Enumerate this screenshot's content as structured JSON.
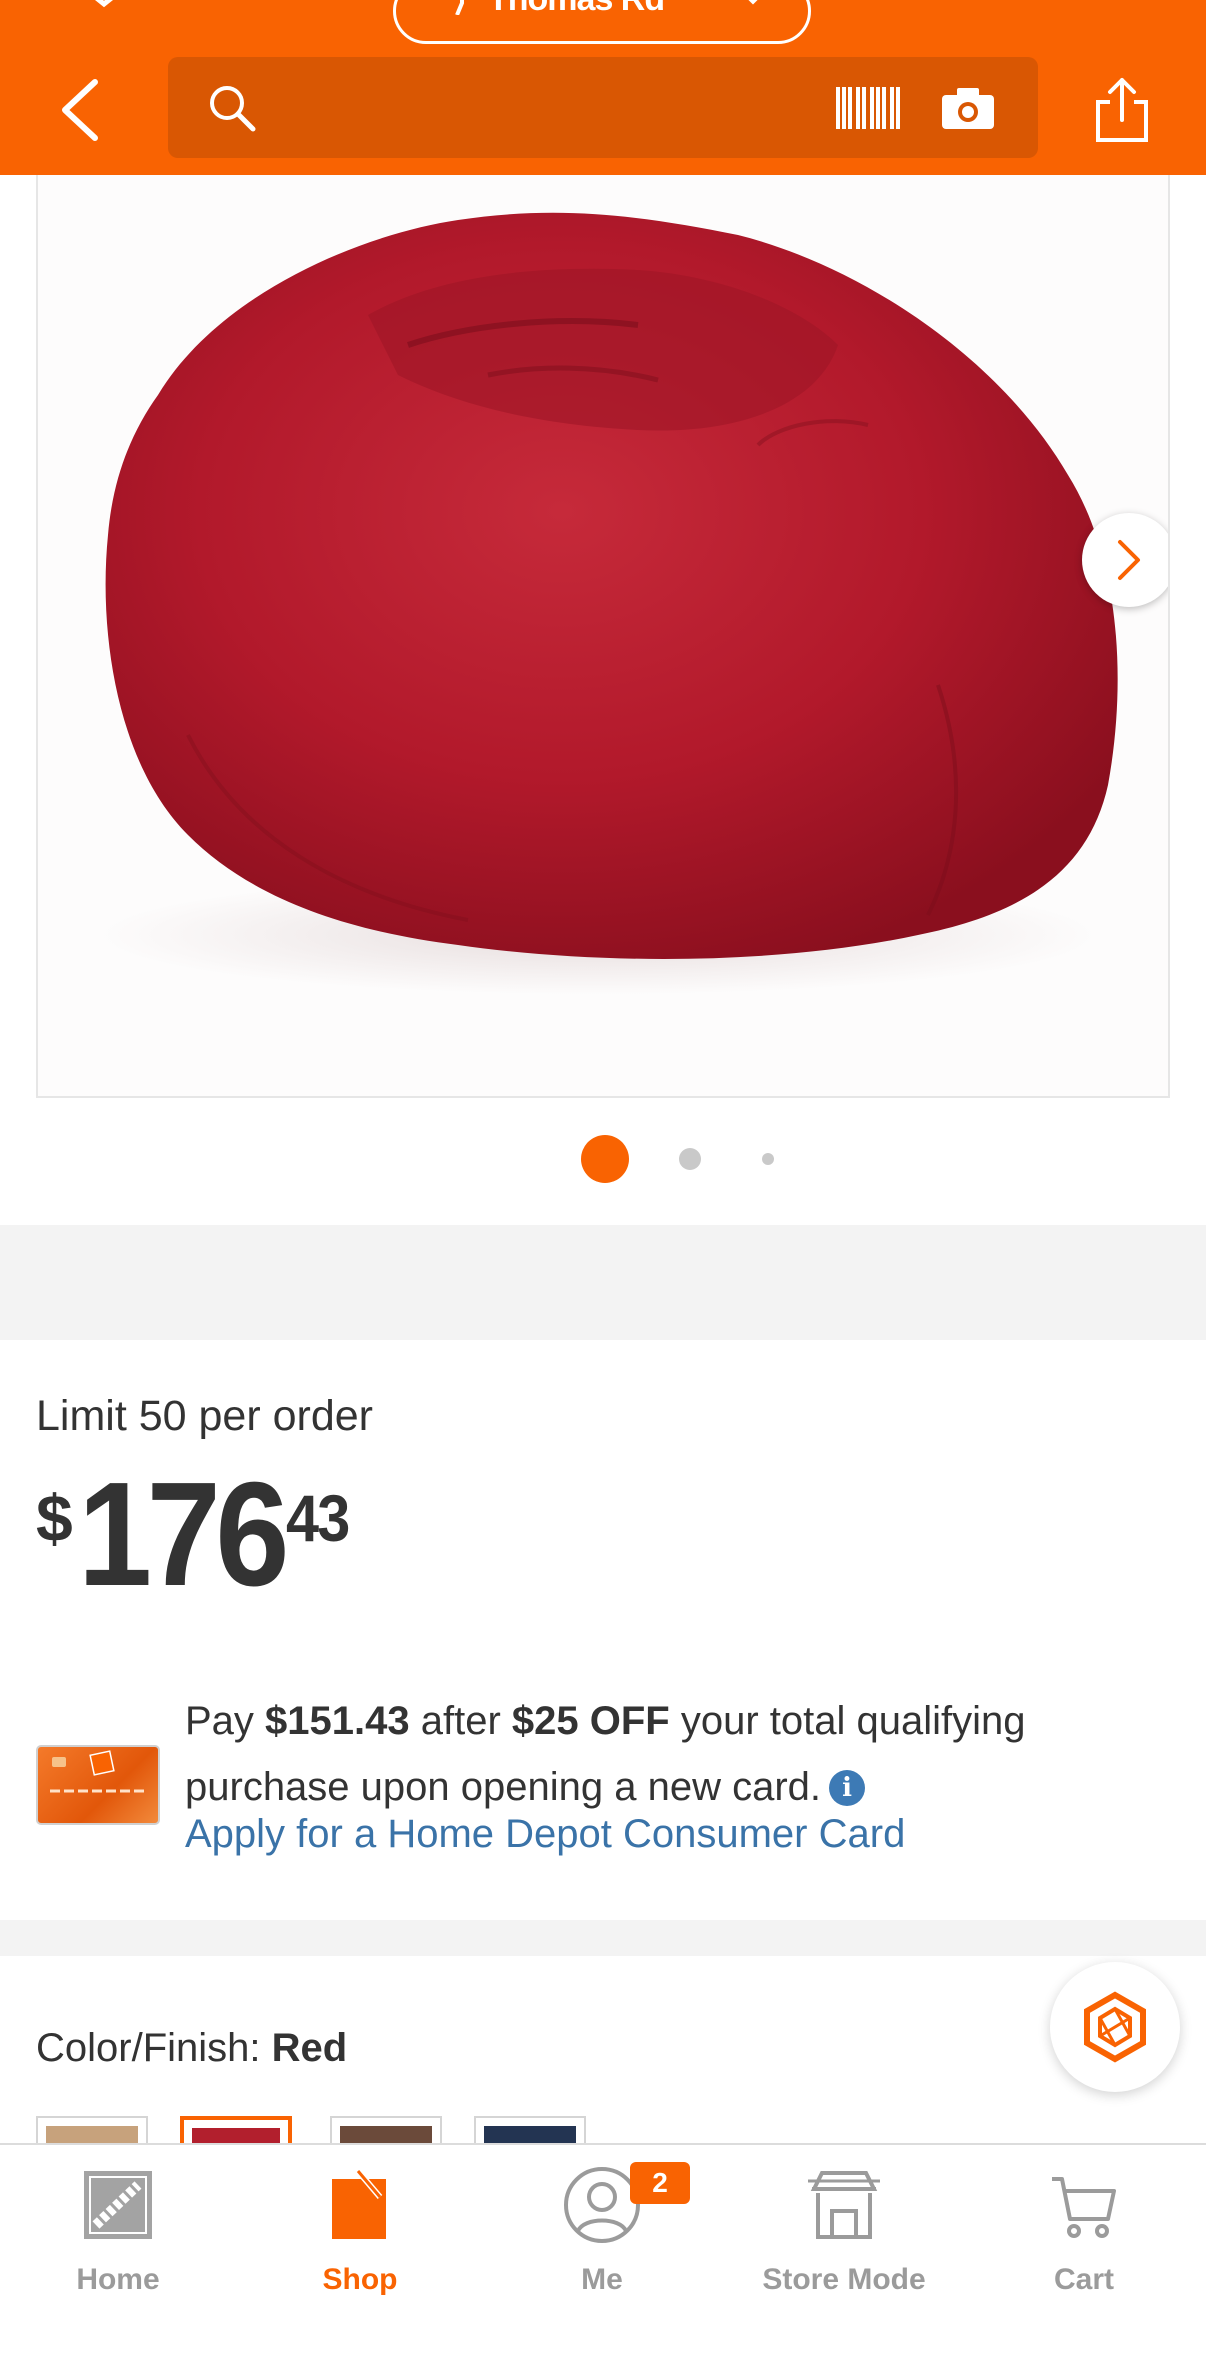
{
  "header": {
    "store_name": "Thomas Rd",
    "search_placeholder": "",
    "icons": [
      "back-arrow-icon",
      "search-icon",
      "barcode-scan-icon",
      "camera-icon",
      "share-icon",
      "location-pin-icon",
      "chevron-down-icon"
    ]
  },
  "gallery": {
    "image_alt": "Red microsuede bean bag chair",
    "dot_count": 3,
    "active_dot": 1
  },
  "price": {
    "limit_text": "Limit 50 per order",
    "currency": "$",
    "dollars": "176",
    "cents": "43"
  },
  "offer": {
    "text_1": "Pay ",
    "amount": "$151.43",
    "text_2": " after ",
    "discount": "$25 OFF",
    "text_3": " your total qualifying purchase upon opening a new card.",
    "link": "Apply for a Home Depot Consumer Card"
  },
  "color_finish": {
    "label": "Color/Finish: ",
    "selected": "Red",
    "swatches": [
      {
        "name": "tan",
        "color": "#c7a27c"
      },
      {
        "name": "red",
        "color": "#b21f2d"
      },
      {
        "name": "brown",
        "color": "#6b4a3a"
      },
      {
        "name": "navy",
        "color": "#233452"
      }
    ]
  },
  "tabbar": {
    "home": "Home",
    "shop": "Shop",
    "me": "Me",
    "me_badge": "2",
    "store_mode": "Store Mode",
    "cart": "Cart"
  },
  "colors": {
    "brand_orange": "#f96302",
    "search_bg": "#d95703",
    "link_blue": "#3a73a8",
    "tab_inactive": "#9b9b9b"
  }
}
